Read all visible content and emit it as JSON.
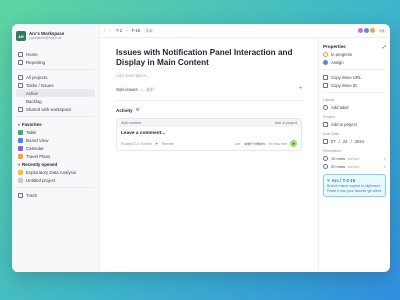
{
  "workspace": {
    "name": "Arc's Workspace",
    "email": "j.goldstein@futuh.ce",
    "initials": "AR"
  },
  "sidebar": {
    "top": [
      {
        "label": "Home"
      },
      {
        "label": "Reporting"
      }
    ],
    "projects": [
      {
        "label": "All projects"
      },
      {
        "label": "Tasks / Issues"
      },
      {
        "label": "Active"
      },
      {
        "label": "Backlog"
      },
      {
        "label": "Shared with workspace"
      }
    ],
    "favorites_title": "Favorites",
    "favorites": [
      {
        "label": "Table"
      },
      {
        "label": "Board View"
      },
      {
        "label": "Calendar"
      },
      {
        "label": "Travel Plans"
      }
    ],
    "recent_title": "Recently opened",
    "recent": [
      {
        "label": "Exploratory Data Analysis"
      },
      {
        "label": "Untitled project"
      }
    ],
    "trash": "Trash"
  },
  "topbar": {
    "nav": "‹ ›",
    "crumb1": "T-2",
    "crumb2": "T-16",
    "counter": "2 4",
    "avatar_count": "+3"
  },
  "issue": {
    "title": "Issues with Notification Panel Interaction and Display in Main Content",
    "description_placeholder": "Add description...",
    "sub_issues_label": "Sub-issues",
    "sub_issues_count": "2 7",
    "activity_label": "Activity"
  },
  "comment": {
    "add_content": "Add content",
    "use_project": "Use a project",
    "placeholder": "Leave a comment...",
    "model": "Flowind 3.0 Sunset",
    "rewrite": "Rewrite",
    "hint_use": "use",
    "hint_keys": "shift + return",
    "hint_new_line": "for new line"
  },
  "properties": {
    "title": "Properties",
    "status": "In progress",
    "assign": "Assign",
    "copy_url": "Copy issue URL",
    "copy_id": "Copy issue ID",
    "labels_label": "Labels",
    "add_label": "Add label",
    "project_label": "Project",
    "add_to_project": "Add to project",
    "due_label": "Due Date",
    "due_month": "07",
    "due_day": "23",
    "due_year": "2024",
    "reminders_label": "Reminders",
    "reminder1_value": "10 mins",
    "reminder1_suffix": "before",
    "reminder2_value": "20 mins",
    "reminder2_suffix": "before"
  },
  "toast": {
    "title": "Arc / T-2-16",
    "body": "Branch name copied to clipboard. Paste it into your favorite git client."
  }
}
